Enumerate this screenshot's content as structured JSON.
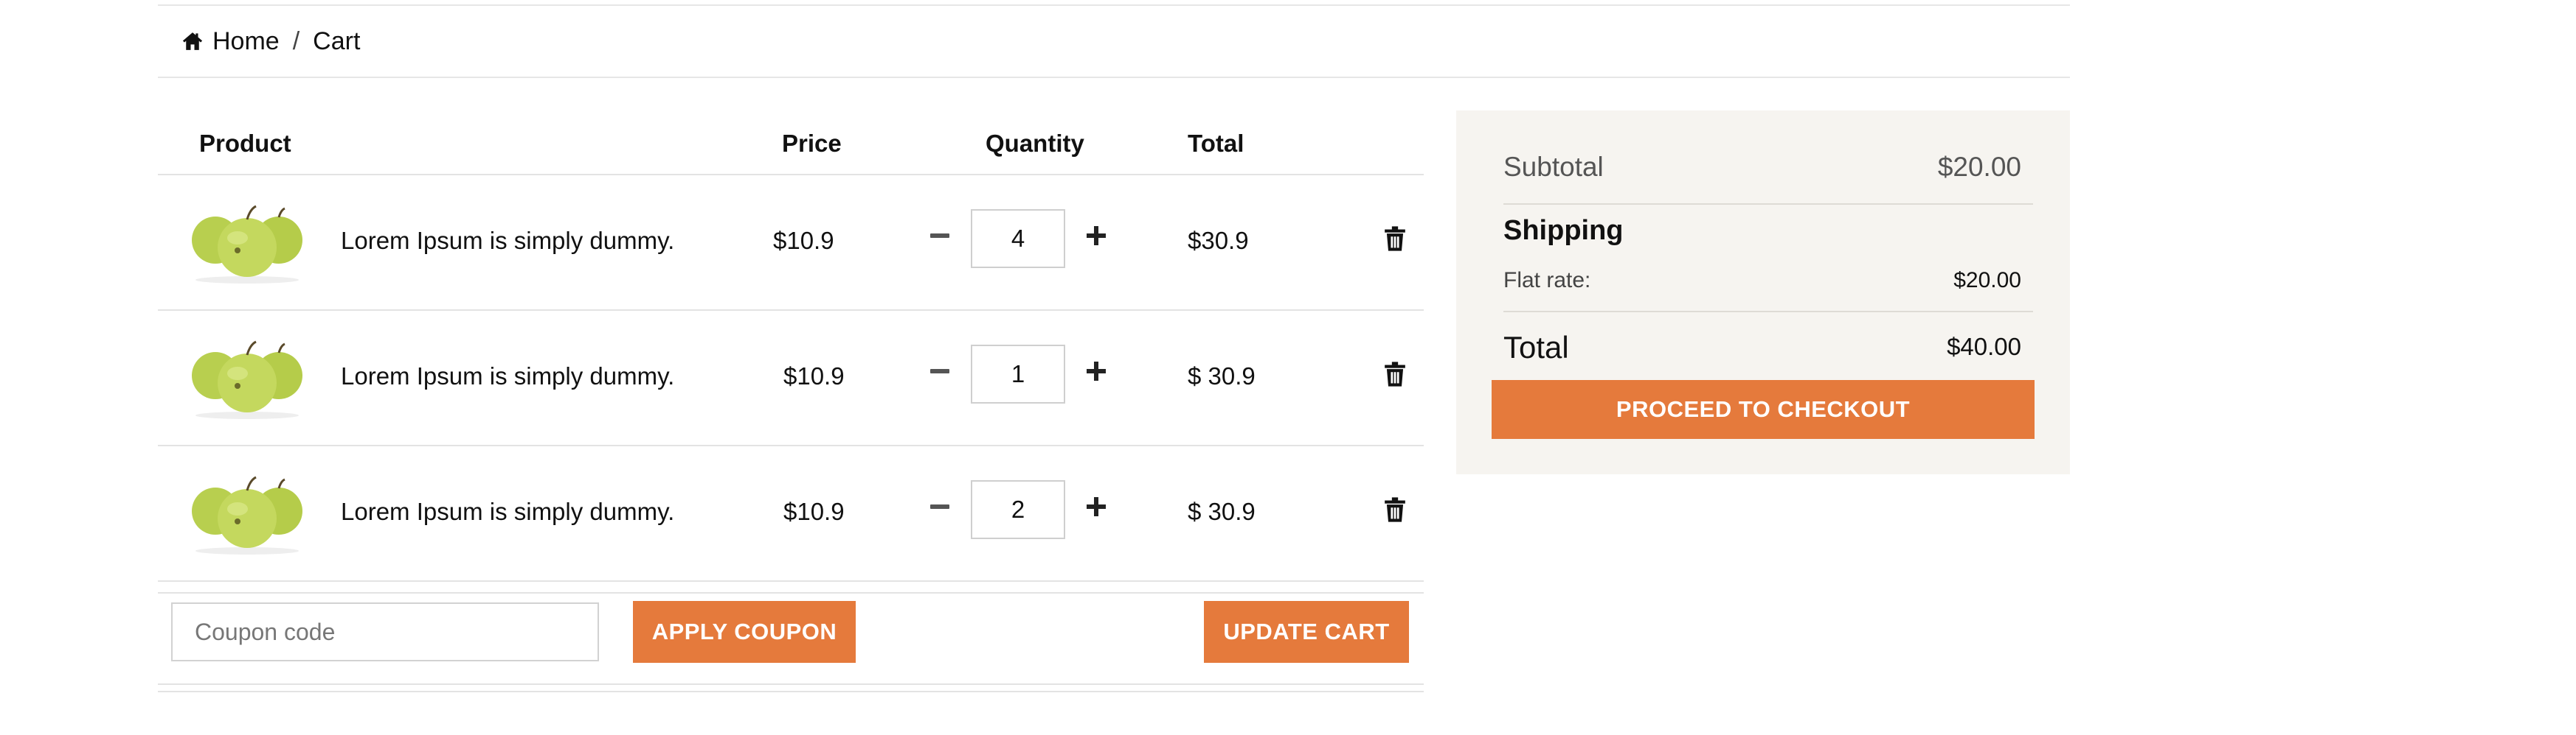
{
  "breadcrumb": {
    "home_icon": "home-icon",
    "home_label": "Home",
    "separator": "/",
    "current_label": "Cart"
  },
  "cart": {
    "headers": {
      "product": "Product",
      "price": "Price",
      "quantity": "Quantity",
      "total": "Total"
    },
    "items": [
      {
        "name": "Lorem Ipsum is simply dummy.",
        "price": "$10.9",
        "quantity": "4",
        "total": "$30.9"
      },
      {
        "name": "Lorem Ipsum is simply dummy.",
        "price": "$10.9",
        "quantity": "1",
        "total": "$ 30.9"
      },
      {
        "name": "Lorem Ipsum is simply dummy.",
        "price": "$10.9",
        "quantity": "2",
        "total": "$ 30.9"
      }
    ],
    "icons": {
      "decrease": "minus-icon",
      "increase": "plus-icon",
      "remove": "trash-icon",
      "thumbnail": "green-apples-image"
    },
    "coupon": {
      "placeholder": "Coupon code",
      "apply_label": "APPLY COUPON"
    },
    "update_label": "UPDATE CART"
  },
  "summary": {
    "subtotal_label": "Subtotal",
    "subtotal_value": "$20.00",
    "shipping_heading": "Shipping",
    "flat_rate_label": "Flat rate:",
    "flat_rate_value": "$20.00",
    "total_label": "Total",
    "total_value": "$40.00",
    "checkout_label": "PROCEED TO CHECKOUT"
  },
  "colors": {
    "accent": "#e57a3c",
    "summary_bg": "#f6f4f0",
    "divider": "#e3e3e3"
  }
}
